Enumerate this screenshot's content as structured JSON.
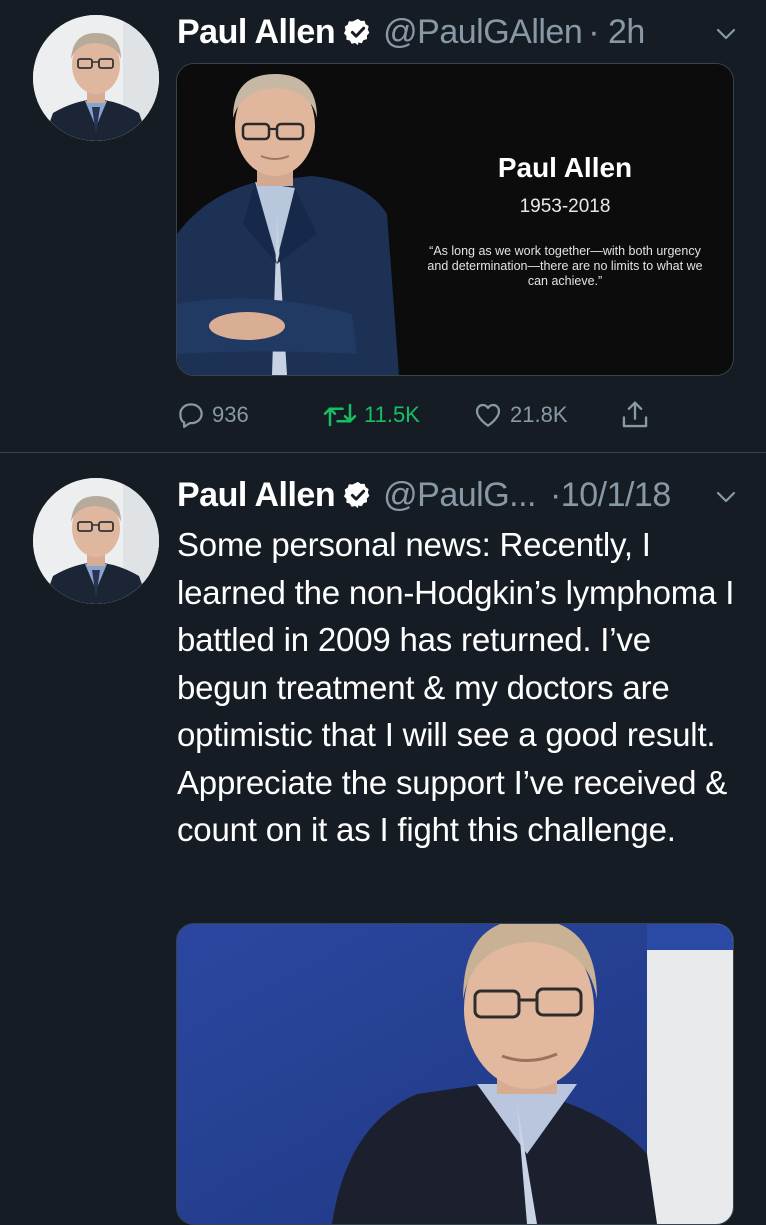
{
  "tweets": [
    {
      "author_name": "Paul Allen",
      "handle": "@PaulGAllen",
      "time": "· 2h",
      "card": {
        "name": "Paul Allen",
        "years": "1953-2018",
        "quote": "“As long as we work together—with both urgency and determination—there are no limits to what we can achieve.”"
      },
      "stats": {
        "replies": "936",
        "retweets": "11.5K",
        "likes": "21.8K"
      },
      "retweeted": true
    },
    {
      "author_name": "Paul Allen",
      "handle": "@PaulG...",
      "time": "·10/1/18",
      "text": "Some personal news: Recently, I learned the non-Hodgkin’s lymphoma I battled in 2009 has returned. I’ve begun treatment & my doctors are optimistic that I will see a good result. Appreciate the support I’ve received & count on it as I fight this challenge."
    }
  ],
  "colors": {
    "background": "#151c24",
    "secondary_text": "#8899a6",
    "retweet_active": "#17bf63",
    "divider": "#38444d"
  },
  "icons": [
    "verified-badge-icon",
    "chevron-down-icon",
    "reply-icon",
    "retweet-icon",
    "like-icon",
    "share-icon"
  ]
}
